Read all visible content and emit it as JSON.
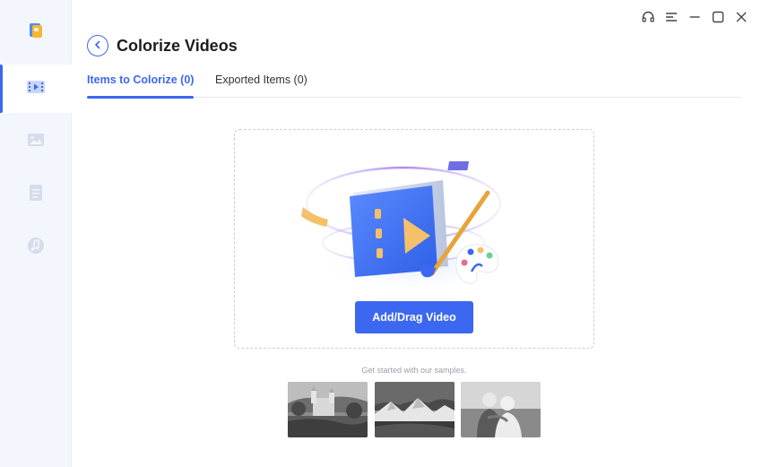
{
  "header": {
    "title": "Colorize Videos"
  },
  "tabs": [
    {
      "label": "Items to Colorize (0)",
      "active": true
    },
    {
      "label": "Exported Items (0)",
      "active": false
    }
  ],
  "sidebar": {
    "items": [
      {
        "icon": "video-icon",
        "active": true
      },
      {
        "icon": "image-icon",
        "active": false
      },
      {
        "icon": "document-icon",
        "active": false
      },
      {
        "icon": "music-icon",
        "active": false
      }
    ]
  },
  "window_controls": [
    "headset-icon",
    "menu-icon",
    "minimize-icon",
    "maximize-icon",
    "close-icon"
  ],
  "dropzone": {
    "button_label": "Add/Drag Video"
  },
  "samples": {
    "label": "Get started with our samples.",
    "items": [
      "castle-sample",
      "mountain-sample",
      "couple-sample"
    ]
  },
  "colors": {
    "accent": "#3c67f0",
    "sidebar_bg": "#f3f6fd"
  }
}
